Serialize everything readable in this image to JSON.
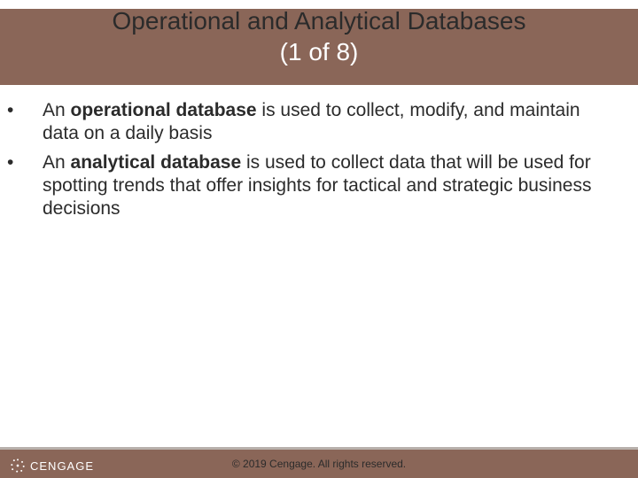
{
  "title": {
    "line1": "Operational and Analytical Databases",
    "line2": "(1 of 8)"
  },
  "bullets": [
    {
      "prefix": "An ",
      "bold": "operational database",
      "rest": " is used to collect, modify, and maintain data on a daily basis"
    },
    {
      "prefix": "An ",
      "bold": "analytical database",
      "rest": " is used to collect data that will be used for spotting trends that offer insights for tactical and strategic business decisions"
    }
  ],
  "footer": {
    "copyright": "© 2019 Cengage. All rights reserved.",
    "brand": "CENGAGE"
  }
}
